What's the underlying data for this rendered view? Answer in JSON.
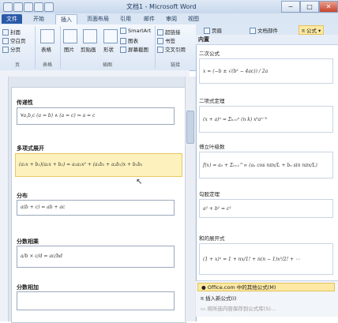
{
  "window": {
    "title": "文档1 - Microsoft Word",
    "min_label": "−",
    "max_label": "□",
    "close_label": "✕"
  },
  "tabs": [
    "文件",
    "开始",
    "插入",
    "页面布局",
    "引用",
    "邮件",
    "审阅",
    "视图"
  ],
  "ribbon": {
    "pages": {
      "label": "页",
      "items": [
        "封面",
        "空白页",
        "分页"
      ]
    },
    "table": {
      "label": "表格",
      "item": "表格"
    },
    "illustrations": {
      "label": "插图",
      "items": [
        "图片",
        "剪贴画",
        "形状",
        "SmartArt",
        "图表",
        "屏幕截图"
      ]
    },
    "links": {
      "label": "链接",
      "items": [
        "超链接",
        "书签",
        "交叉引用"
      ]
    },
    "right_items": [
      "页眉",
      "文档部件",
      "公式"
    ]
  },
  "document": {
    "sections": [
      {
        "title": "传递性",
        "formula": "∀a,b,c (a = b) ∧ (a = c) ⇒ a = c"
      },
      {
        "title": "多项式展开",
        "formula": "(a₁x + b₁)(a₂x + b₂) = a₁a₂x² + (a₁b₂ + a₂b₁)x + b₁b₂"
      },
      {
        "title": "分布",
        "formula": "a(b + c) = ab + ac"
      },
      {
        "title": "分数相乘",
        "formula": "a/b × c/d = ac/bd"
      },
      {
        "title": "分数相加",
        "formula": ""
      }
    ]
  },
  "gallery": {
    "header": "内置",
    "items": [
      {
        "title": "二次公式",
        "formula": "x = (−b ± √(b² − 4ac)) / 2a"
      },
      {
        "title": "二项式定理",
        "formula": "(x + a)ⁿ = Σₖ₌₀ⁿ (n k) xᵏaⁿ⁻ᵏ"
      },
      {
        "title": "傅立叶级数",
        "formula": "f(x) = a₀ + Σₙ₌₁^∞ (aₙ cos nπx/L + bₙ sin nπx/L)"
      },
      {
        "title": "勾股定理",
        "formula": "a² + b² = c²"
      },
      {
        "title": "和的展开式",
        "formula": "(1 + x)ⁿ = 1 + nx/1! + n(n − 1)x²/2! + ⋯"
      }
    ],
    "footer": {
      "office": "Office.com 中的其他公式(M)",
      "insert_new": "插入新公式(I)",
      "save_selection": "将所选内容保存到公式库(S)..."
    }
  }
}
